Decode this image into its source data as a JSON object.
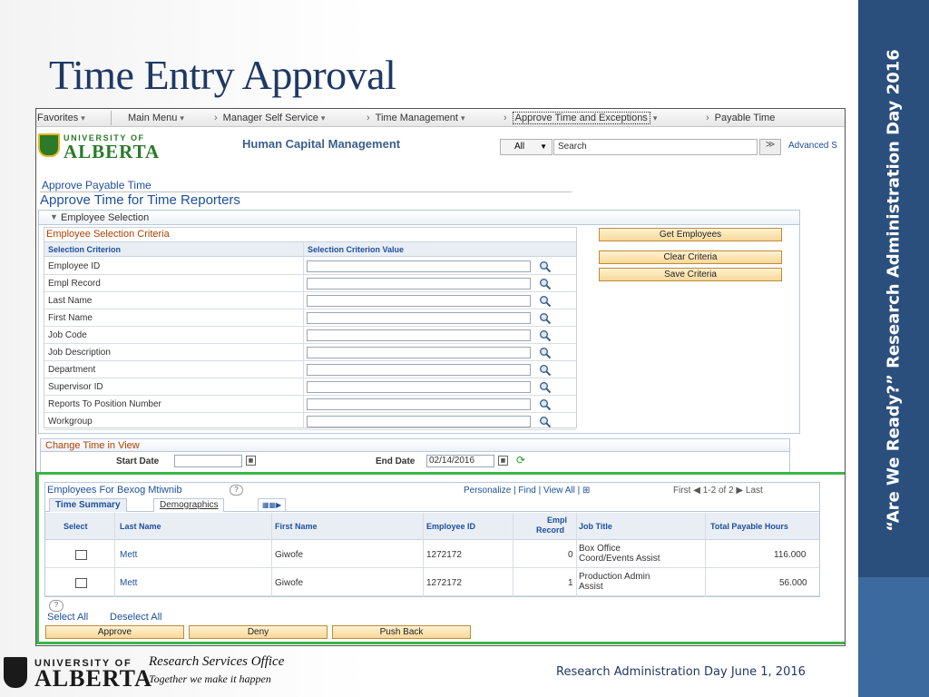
{
  "slide": {
    "title": "Time Entry Approval",
    "side_banner": "“Are We Ready?” Research Administration Day 2016",
    "footer_org": "Research Services Office",
    "footer_tagline": "Together we make it happen",
    "footer_event": "Research Administration Day June 1, 2016",
    "logo_top": "UNIVERSITY OF",
    "logo_main": "ALBERTA"
  },
  "menu": {
    "favorites": "Favorites",
    "main_menu": "Main Menu",
    "manager_self_service": "Manager Self Service",
    "time_management": "Time Management",
    "approve_time": "Approve Time and Exceptions",
    "payable_time": "Payable Time"
  },
  "banner": {
    "app_title": "Human Capital Management",
    "search_scope": "All",
    "search_value": "Search",
    "search_go": "≫",
    "advanced": "Advanced S"
  },
  "page": {
    "subtitle": "Approve Payable Time",
    "title": "Approve Time for Time Reporters"
  },
  "employee_selection": {
    "section_label": "Employee Selection",
    "criteria_title": "Employee Selection Criteria",
    "col_criterion": "Selection Criterion",
    "col_value": "Selection Criterion Value",
    "criteria": [
      "Employee ID",
      "Empl Record",
      "Last Name",
      "First Name",
      "Job Code",
      "Job Description",
      "Department",
      "Supervisor ID",
      "Reports To Position Number",
      "Workgroup"
    ],
    "buttons": {
      "get_employees": "Get Employees",
      "clear_criteria": "Clear Criteria",
      "save_criteria": "Save Criteria"
    }
  },
  "change_time": {
    "title": "Change Time in View",
    "start_label": "Start Date",
    "start_value": "",
    "end_label": "End Date",
    "end_value": "02/14/2016"
  },
  "employees_grid": {
    "title": "Employees For Bexog Mtiwnib",
    "tools": "Personalize | Find | View All |",
    "nav_first": "First",
    "nav_range": "1-2 of 2",
    "nav_last": "Last",
    "tabs": [
      "Time Summary",
      "Demographics"
    ],
    "columns": {
      "select": "Select",
      "last_name": "Last Name",
      "first_name": "First Name",
      "employee_id": "Employee ID",
      "empl_record_1": "Empl",
      "empl_record_2": "Record",
      "job_title": "Job Title",
      "total_hours": "Total Payable Hours"
    },
    "rows": [
      {
        "last_name": "Mett",
        "first_name": "Giwofe",
        "employee_id": "1272172",
        "empl_record": "0",
        "job_title_1": "Box Office",
        "job_title_2": "Coord/Events Assist",
        "total_hours": "116.000"
      },
      {
        "last_name": "Mett",
        "first_name": "Giwofe",
        "employee_id": "1272172",
        "empl_record": "1",
        "job_title_1": "Production Admin",
        "job_title_2": "Assist",
        "total_hours": "56.000"
      }
    ],
    "select_all": "Select All",
    "deselect_all": "Deselect All",
    "actions": {
      "approve": "Approve",
      "deny": "Deny",
      "push_back": "Push Back"
    }
  }
}
